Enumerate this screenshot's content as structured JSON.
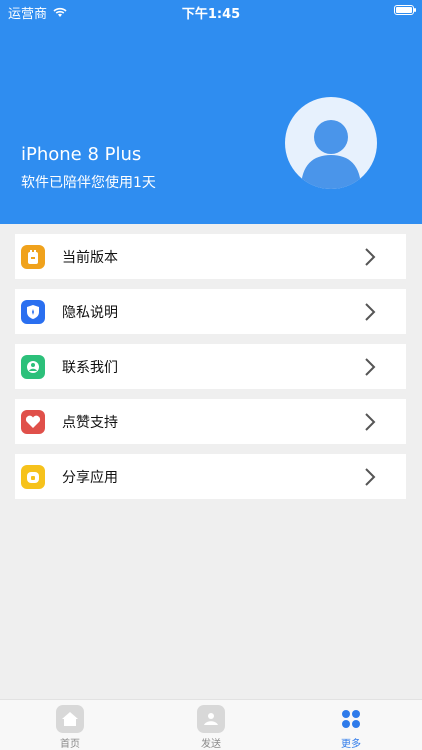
{
  "status_bar": {
    "carrier": "运营商",
    "time": "下午1:45"
  },
  "header": {
    "device_name": "iPhone 8 Plus",
    "usage_text": "软件已陪伴您使用1天"
  },
  "menu": {
    "items": [
      {
        "label": "当前版本",
        "icon": "version-icon",
        "color": "#f0a21c"
      },
      {
        "label": "隐私说明",
        "icon": "shield-icon",
        "color": "#2a6ff0"
      },
      {
        "label": "联系我们",
        "icon": "contact-icon",
        "color": "#2cc07a"
      },
      {
        "label": "点赞支持",
        "icon": "heart-icon",
        "color": "#e0504a"
      },
      {
        "label": "分享应用",
        "icon": "share-icon",
        "color": "#f6c21c"
      }
    ]
  },
  "tabbar": {
    "tabs": [
      {
        "label": "首页",
        "icon": "home-icon",
        "active": false
      },
      {
        "label": "发送",
        "icon": "send-icon",
        "active": false
      },
      {
        "label": "更多",
        "icon": "more-icon",
        "active": true
      }
    ]
  },
  "colors": {
    "accent": "#2f8df0",
    "background": "#efefef"
  }
}
